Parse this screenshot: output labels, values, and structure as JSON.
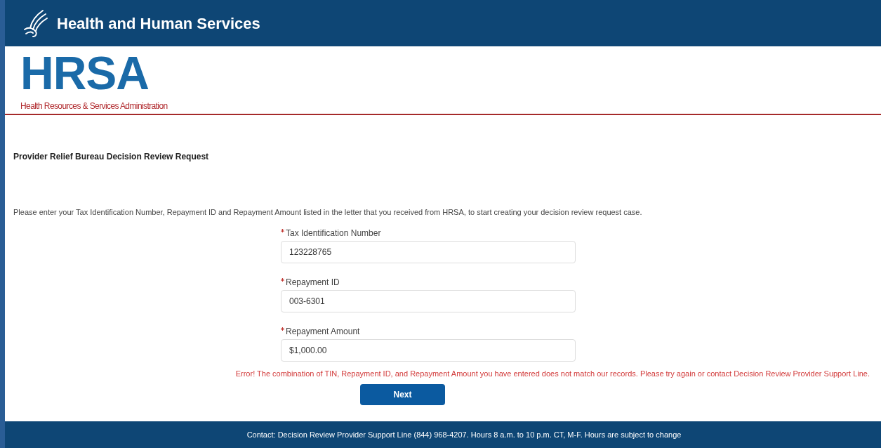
{
  "header": {
    "title": "Health and Human Services"
  },
  "logo": {
    "acronym": "HRSA",
    "subtitle": "Health Resources & Services Administration"
  },
  "page_title": "Provider Relief Bureau Decision Review Request",
  "instructions": "Please enter your Tax Identification Number, Repayment ID and Repayment Amount listed in the letter that you received from HRSA, to start creating your decision review request case.",
  "fields": [
    {
      "label": "Tax Identification Number",
      "value": "123228765",
      "required": true
    },
    {
      "label": "Repayment ID",
      "value": "003-6301",
      "required": true
    },
    {
      "label": "Repayment Amount",
      "value": "$1,000.00",
      "required": true
    }
  ],
  "error": "Error! The combination of TIN, Repayment ID, and Repayment Amount you have entered does not match our records. Please try again or contact Decision Review Provider Support Line.",
  "buttons": [
    "Next"
  ],
  "footer": "Contact: Decision Review Provider Support Line (844) 968-4207. Hours 8 a.m. to 10 p.m. CT, M-F. Hours are subject to change"
}
